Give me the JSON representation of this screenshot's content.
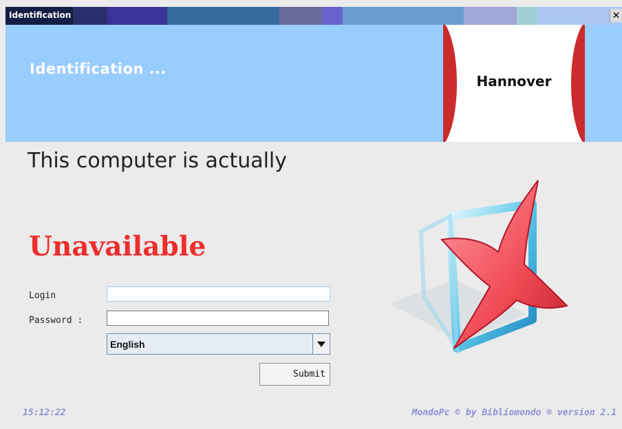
{
  "window": {
    "title": "Identification",
    "close_label": "✕"
  },
  "header": {
    "title": "Identification ...",
    "logo_text": "Hannover"
  },
  "main": {
    "message": "This computer is actually",
    "status": "Unavailable",
    "login": {
      "label": "Login",
      "value": ""
    },
    "password": {
      "label": "Password :",
      "value": ""
    },
    "language": {
      "selected": "English"
    },
    "submit_label": "Submit"
  },
  "footer": {
    "clock": "15:12:22",
    "credits": "MondoPc © by Bibliomondo ® version 2.1"
  },
  "icons": {
    "status_icon": "red-x-icon",
    "dropdown_icon": "triangle-down-icon"
  },
  "colors": {
    "header_bg": "#99ccff",
    "status_red": "#ee2e2e",
    "footer_text": "#8f8fd6",
    "body_bg": "#ebebeb"
  }
}
